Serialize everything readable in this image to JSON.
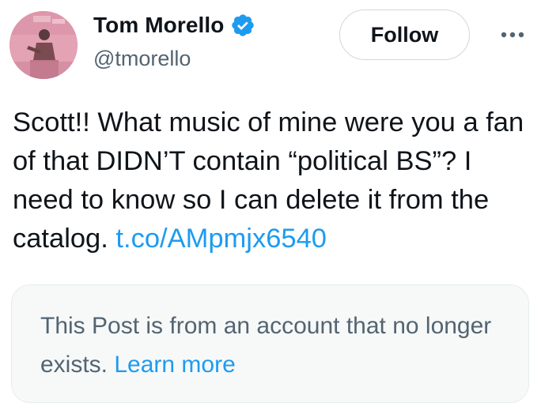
{
  "author": {
    "display_name": "Tom Morello",
    "handle": "@tmorello",
    "verified": true
  },
  "actions": {
    "follow_label": "Follow",
    "more_icon": "ellipsis-icon"
  },
  "tweet": {
    "text": "Scott!! What music of mine were you a fan of that DIDN’T contain “political BS”? I need to know so I can delete it from the catalog. ",
    "link_text": "t.co/AMpmjx6540"
  },
  "notice": {
    "text": "This Post is from an account that no longer exists. ",
    "link_text": "Learn more"
  },
  "colors": {
    "text": "#0f1419",
    "secondary": "#536471",
    "link": "#1d9bf0",
    "verified": "#1d9bf0",
    "notice_bg": "#f7f9f9",
    "border": "#cfd9de"
  }
}
